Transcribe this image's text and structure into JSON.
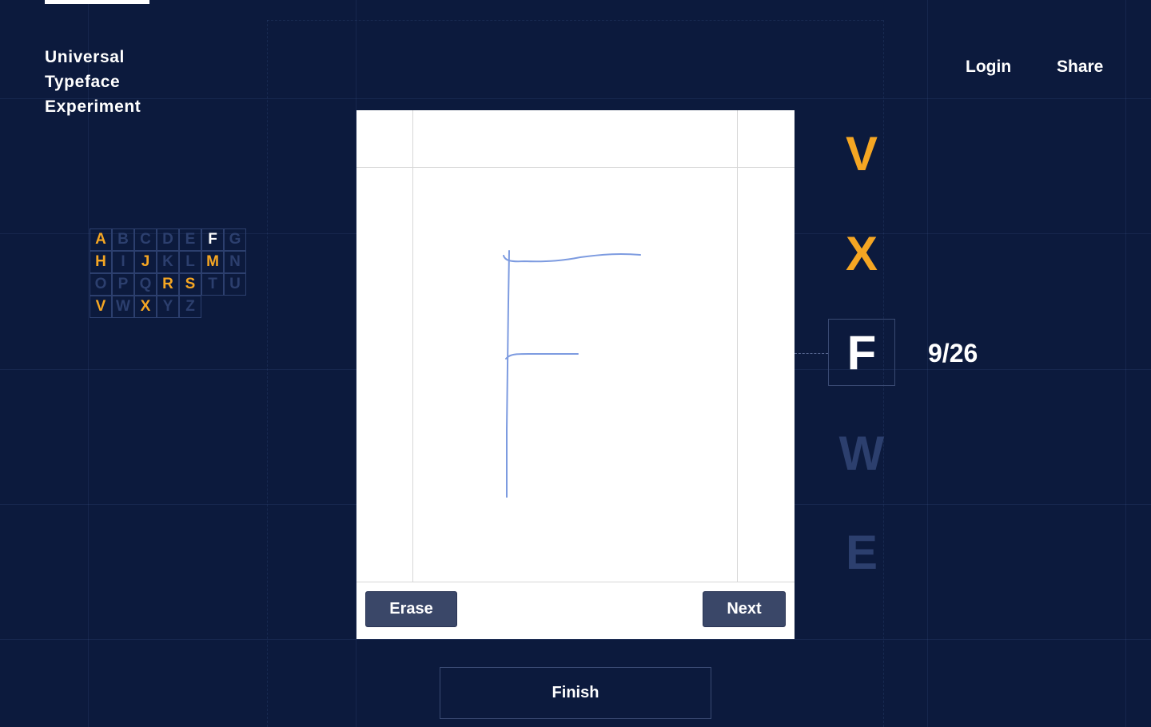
{
  "app": {
    "brand_lines": [
      "Universal",
      "Typeface",
      "Experiment"
    ]
  },
  "nav": {
    "login": "Login",
    "share": "Share"
  },
  "alphabet": [
    {
      "letter": "A",
      "state": "done"
    },
    {
      "letter": "B",
      "state": "todo"
    },
    {
      "letter": "C",
      "state": "todo"
    },
    {
      "letter": "D",
      "state": "todo"
    },
    {
      "letter": "E",
      "state": "todo"
    },
    {
      "letter": "F",
      "state": "current"
    },
    {
      "letter": "G",
      "state": "todo"
    },
    {
      "letter": "H",
      "state": "done"
    },
    {
      "letter": "I",
      "state": "todo"
    },
    {
      "letter": "J",
      "state": "done"
    },
    {
      "letter": "K",
      "state": "todo"
    },
    {
      "letter": "L",
      "state": "todo"
    },
    {
      "letter": "M",
      "state": "done"
    },
    {
      "letter": "N",
      "state": "todo"
    },
    {
      "letter": "O",
      "state": "todo"
    },
    {
      "letter": "P",
      "state": "todo"
    },
    {
      "letter": "Q",
      "state": "todo"
    },
    {
      "letter": "R",
      "state": "done"
    },
    {
      "letter": "S",
      "state": "done"
    },
    {
      "letter": "T",
      "state": "todo"
    },
    {
      "letter": "U",
      "state": "todo"
    },
    {
      "letter": "V",
      "state": "done"
    },
    {
      "letter": "W",
      "state": "todo"
    },
    {
      "letter": "X",
      "state": "done"
    },
    {
      "letter": "Y",
      "state": "todo"
    },
    {
      "letter": "Z",
      "state": "todo"
    }
  ],
  "queue": {
    "previous": [
      "V",
      "X"
    ],
    "current": "F",
    "next": [
      "W",
      "E"
    ],
    "progress": "9/26"
  },
  "canvas": {
    "erase_label": "Erase",
    "next_label": "Next"
  },
  "finish_label": "Finish",
  "colors": {
    "background": "#0c1a3d",
    "done": "#f5a623",
    "todo": "#2c3f6e",
    "current": "#ffffff",
    "stroke": "#7d9be0",
    "button": "#3a4768"
  }
}
